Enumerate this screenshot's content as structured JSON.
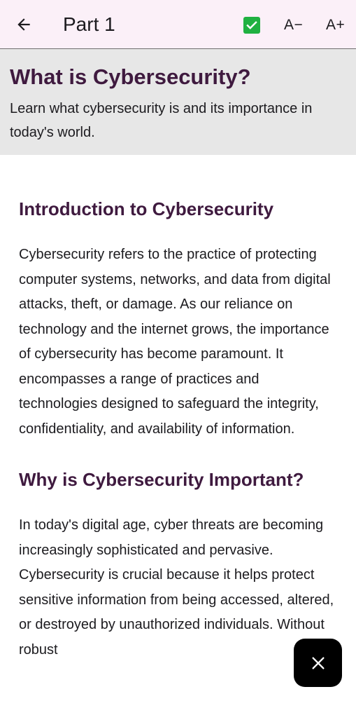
{
  "app_bar": {
    "title": "Part 1",
    "font_decrease_label": "A−",
    "font_increase_label": "A+",
    "completed": true,
    "icons": {
      "back": "arrow-back-icon",
      "complete": "checkbox-checked-icon"
    }
  },
  "lesson": {
    "title": "What is Cybersecurity?",
    "subtitle": "Learn what cybersecurity is and its importance in today's world."
  },
  "sections": [
    {
      "heading": "Introduction to Cybersecurity",
      "body": "Cybersecurity refers to the practice of protecting computer systems, networks, and data from digital attacks, theft, or damage. As our reliance on technology and the internet grows, the importance of cybersecurity has become paramount. It encompasses a range of practices and technologies designed to safeguard the integrity, confidentiality, and availability of information."
    },
    {
      "heading": "Why is Cybersecurity Important?",
      "body": "In today's digital age, cyber threats are becoming increasingly sophisticated and pervasive. Cybersecurity is crucial because it helps protect sensitive information from being accessed, altered, or destroyed by unauthorized individuals. Without robust"
    }
  ],
  "fab": {
    "icon": "close-icon"
  },
  "colors": {
    "app_bar_bg": "#fbf0f8",
    "header_bg": "#e7e7e7",
    "heading_color": "#3f1a3f",
    "check_green": "#1fb141",
    "fab_bg": "#000000"
  }
}
